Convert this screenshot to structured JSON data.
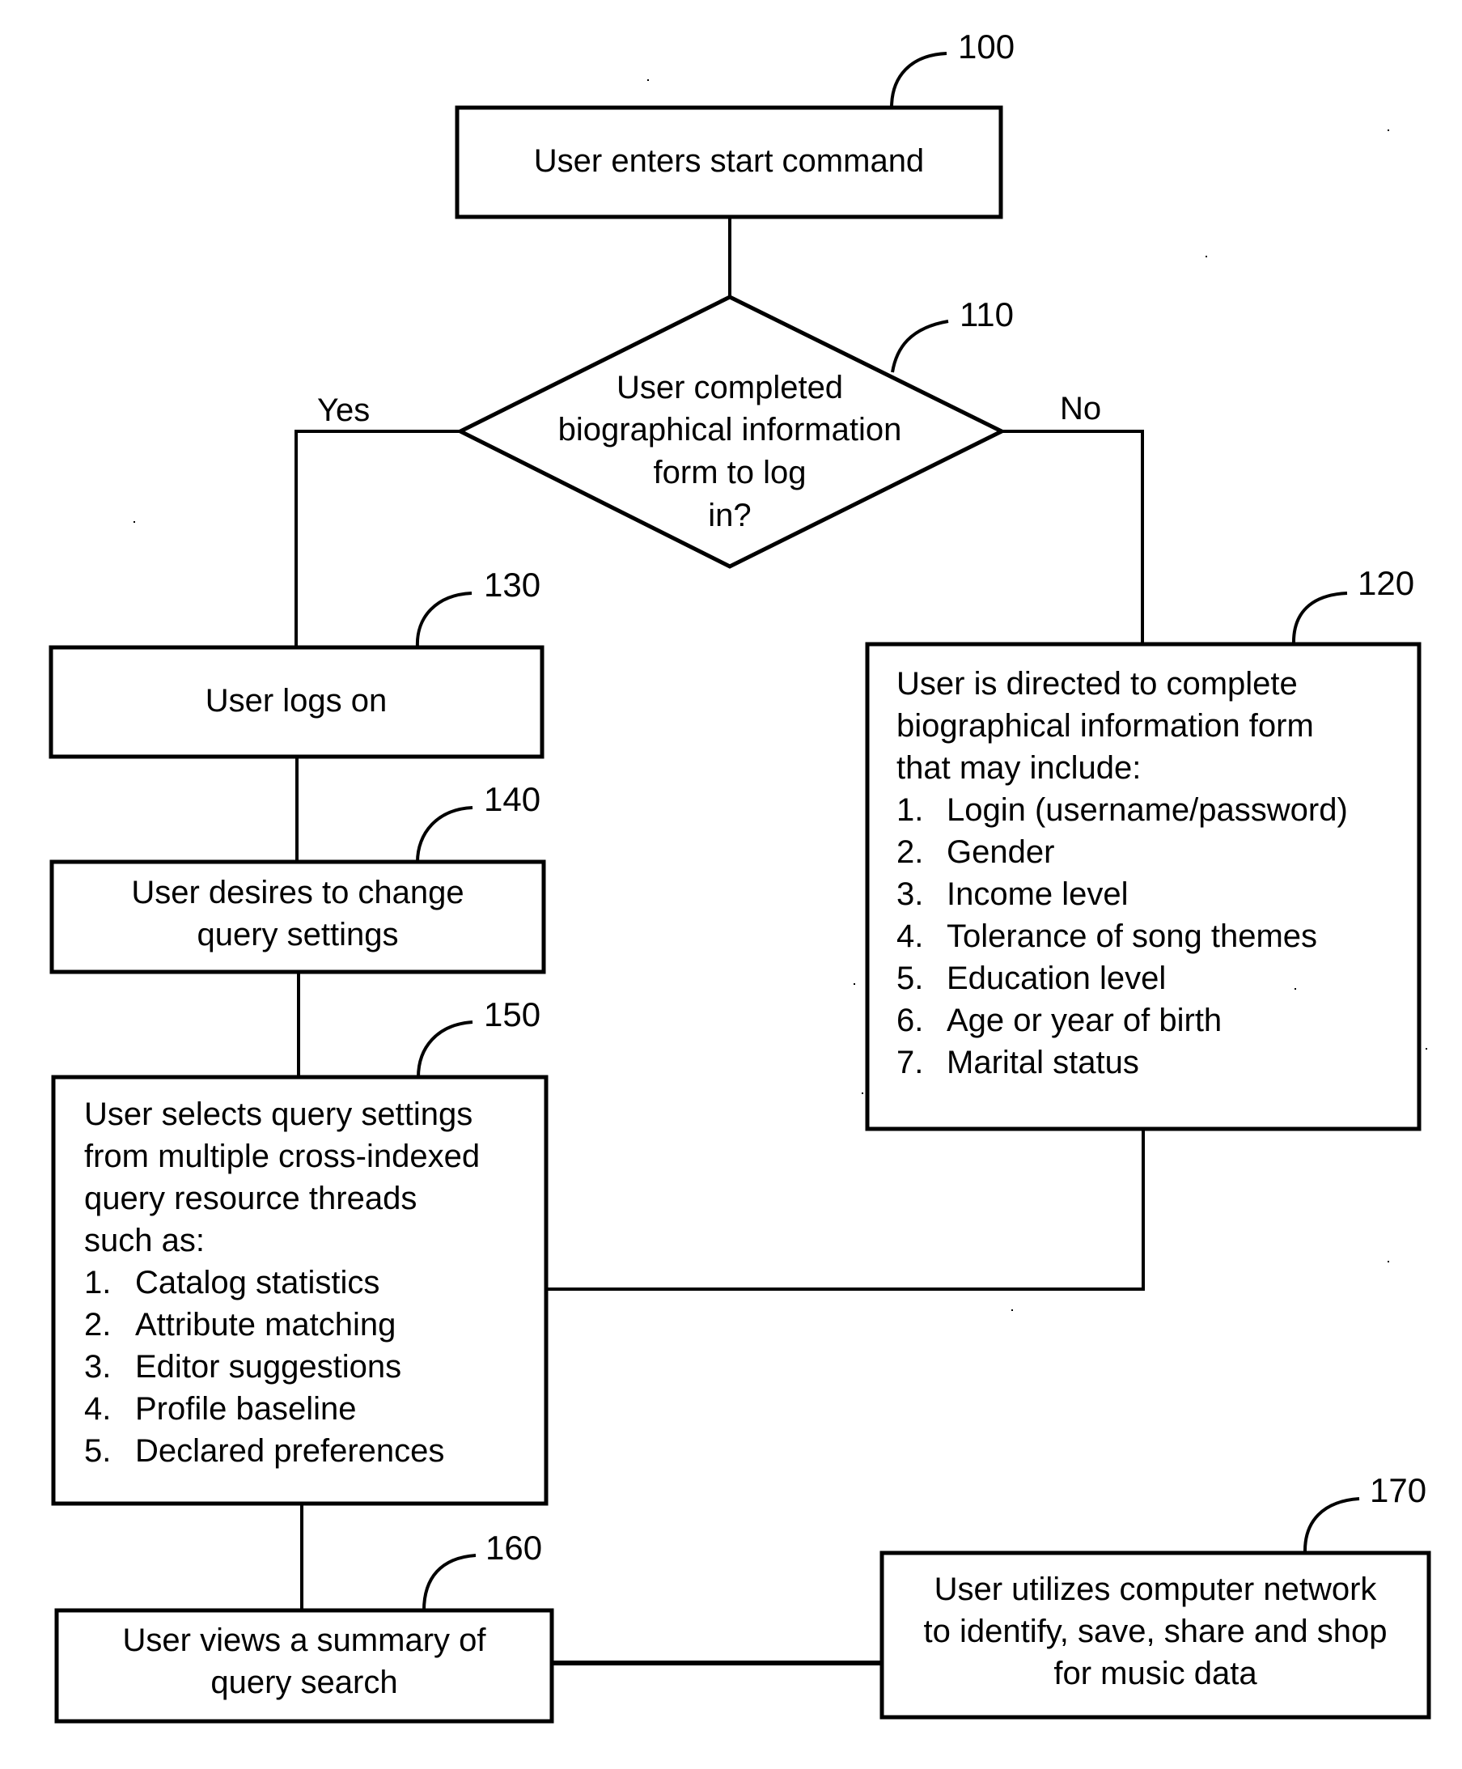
{
  "diagram": {
    "type": "flowchart",
    "nodes": {
      "start": {
        "ref": "100",
        "lines": [
          "User enters start command"
        ]
      },
      "decision": {
        "ref": "110",
        "lines": [
          "User completed",
          "biographical information",
          "form to log",
          "in?"
        ],
        "yes_label": "Yes",
        "no_label": "No"
      },
      "bio_form": {
        "ref": "120",
        "intro": [
          "User is directed to complete",
          "biographical information form",
          "that may include:"
        ],
        "items": [
          {
            "num": "1.",
            "text": "Login (username/password)"
          },
          {
            "num": "2.",
            "text": "Gender"
          },
          {
            "num": "3.",
            "text": "Income level"
          },
          {
            "num": "4.",
            "text": "Tolerance of song themes"
          },
          {
            "num": "5.",
            "text": "Education level"
          },
          {
            "num": "6.",
            "text": "Age or year of birth"
          },
          {
            "num": "7.",
            "text": "Marital status"
          }
        ]
      },
      "logon": {
        "ref": "130",
        "lines": [
          "User logs on"
        ]
      },
      "change_settings": {
        "ref": "140",
        "lines": [
          "User desires to change",
          "query settings"
        ]
      },
      "select_settings": {
        "ref": "150",
        "intro": [
          "User selects query settings",
          "from multiple cross-indexed",
          "query resource threads",
          "such as:"
        ],
        "items": [
          {
            "num": "1.",
            "text": "Catalog statistics"
          },
          {
            "num": "2.",
            "text": "Attribute matching"
          },
          {
            "num": "3.",
            "text": "Editor suggestions"
          },
          {
            "num": "4.",
            "text": "Profile baseline"
          },
          {
            "num": "5.",
            "text": "Declared preferences"
          }
        ]
      },
      "summary": {
        "ref": "160",
        "lines": [
          "User views a summary of",
          "query search"
        ]
      },
      "network": {
        "ref": "170",
        "lines": [
          "User utilizes computer network",
          "to identify, save, share and shop",
          "for music data"
        ]
      }
    },
    "edges": [
      {
        "from": "start",
        "to": "decision",
        "label": ""
      },
      {
        "from": "decision",
        "to": "logon",
        "label": "Yes"
      },
      {
        "from": "decision",
        "to": "bio_form",
        "label": "No"
      },
      {
        "from": "logon",
        "to": "change_settings",
        "label": ""
      },
      {
        "from": "change_settings",
        "to": "select_settings",
        "label": ""
      },
      {
        "from": "bio_form",
        "to": "select_settings",
        "label": ""
      },
      {
        "from": "select_settings",
        "to": "summary",
        "label": ""
      },
      {
        "from": "summary",
        "to": "network",
        "label": ""
      }
    ]
  }
}
